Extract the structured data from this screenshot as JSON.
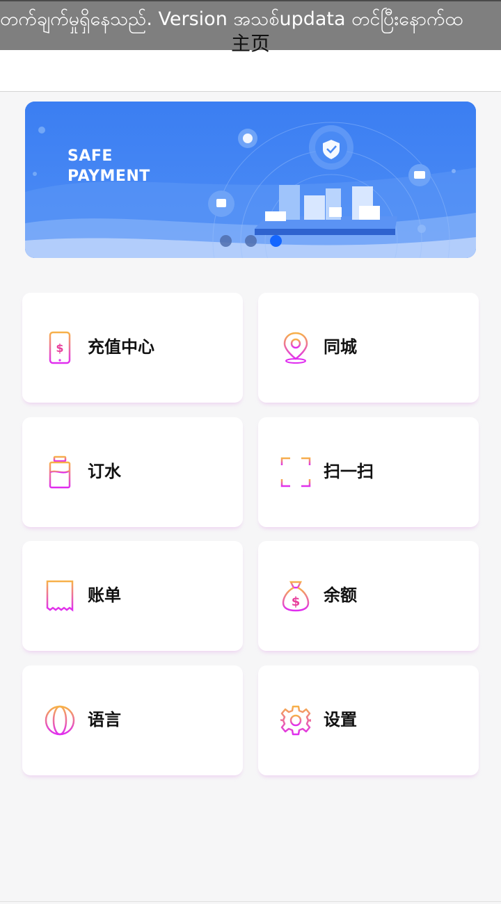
{
  "notice": {
    "text": "တက်ချက်မှုရှိနေသည်. Version အသစ်updata တင်ပြီးနောက်ထ"
  },
  "header": {
    "title": "主页"
  },
  "banner": {
    "line1": "SAFE",
    "line2": "PAYMENT",
    "slides": 3,
    "active_slide": 3
  },
  "menu": {
    "items": [
      {
        "label": "充值中心",
        "icon": "phone-dollar-icon"
      },
      {
        "label": "同城",
        "icon": "location-pin-icon"
      },
      {
        "label": "订水",
        "icon": "water-bottle-icon"
      },
      {
        "label": "扫一扫",
        "icon": "scan-icon"
      },
      {
        "label": "账单",
        "icon": "bill-icon"
      },
      {
        "label": "余额",
        "icon": "money-bag-icon"
      },
      {
        "label": "语言",
        "icon": "globe-icon"
      },
      {
        "label": "设置",
        "icon": "gear-icon"
      }
    ]
  },
  "colors": {
    "icon_gradient_start": "#f7b148",
    "icon_gradient_end": "#e02df0",
    "banner_blue": "#3a7cf0",
    "active_dot": "#1466ff"
  }
}
